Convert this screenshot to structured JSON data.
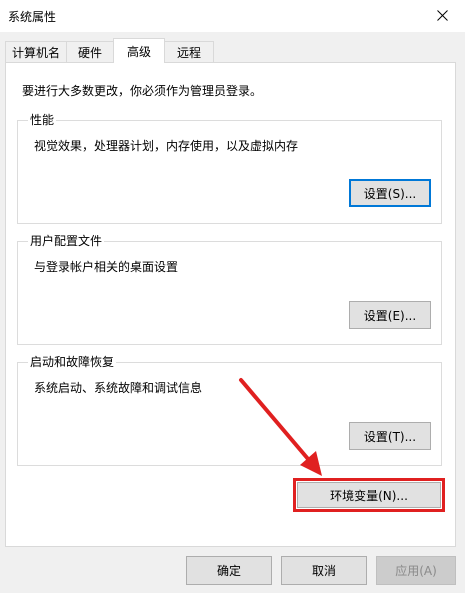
{
  "window": {
    "title": "系统属性",
    "close_icon": "close-icon"
  },
  "tabs": [
    {
      "label": "计算机名",
      "active": false
    },
    {
      "label": "硬件",
      "active": false
    },
    {
      "label": "高级",
      "active": true
    },
    {
      "label": "远程",
      "active": false
    }
  ],
  "advanced": {
    "admin_note": "要进行大多数更改，你必须作为管理员登录。",
    "performance": {
      "title": "性能",
      "description": "视觉效果，处理器计划，内存使用，以及虚拟内存",
      "button": "设置(S)..."
    },
    "user_profiles": {
      "title": "用户配置文件",
      "description": "与登录帐户相关的桌面设置",
      "button": "设置(E)..."
    },
    "startup_recovery": {
      "title": "启动和故障恢复",
      "description": "系统启动、系统故障和调试信息",
      "button": "设置(T)..."
    },
    "env_vars_button": "环境变量(N)..."
  },
  "footer": {
    "ok": "确定",
    "cancel": "取消",
    "apply": "应用(A)"
  },
  "colors": {
    "annotation": "#e02020",
    "focus": "#0078d7"
  }
}
